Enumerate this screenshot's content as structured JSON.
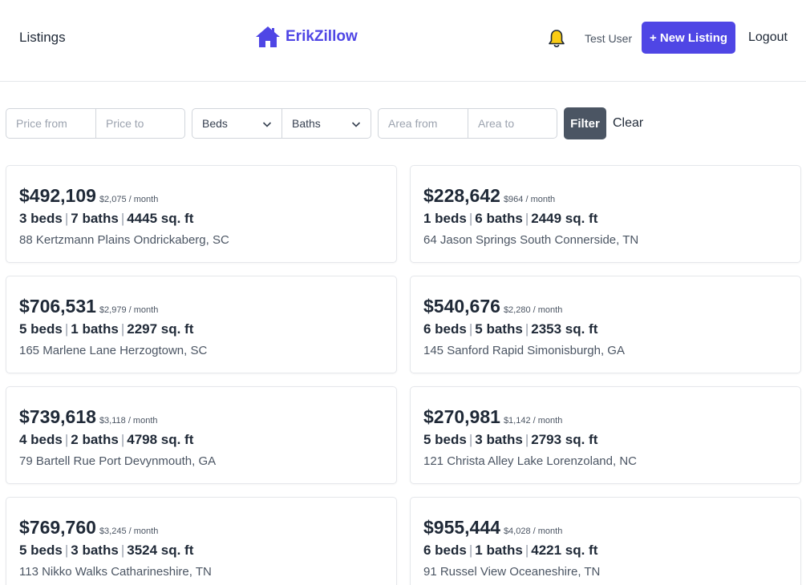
{
  "header": {
    "nav_listings": "Listings",
    "brand_name": "ErikZillow",
    "user_name": "Test User",
    "new_listing_label": "+ New Listing",
    "logout_label": "Logout",
    "brand_color": "#4f46e5",
    "bell_color": "#facc15"
  },
  "filters": {
    "price_from_placeholder": "Price from",
    "price_to_placeholder": "Price to",
    "beds_label": "Beds",
    "baths_label": "Baths",
    "area_from_placeholder": "Area from",
    "area_to_placeholder": "Area to",
    "filter_label": "Filter",
    "clear_label": "Clear"
  },
  "listings": [
    {
      "price": "$492,109",
      "monthly": "$2,075 / month",
      "beds": "3 beds",
      "baths": "7 baths",
      "area": "4445 sq. ft",
      "address": "88 Kertzmann Plains Ondrickaberg, SC"
    },
    {
      "price": "$228,642",
      "monthly": "$964 / month",
      "beds": "1 beds",
      "baths": "6 baths",
      "area": "2449 sq. ft",
      "address": "64 Jason Springs South Connerside, TN"
    },
    {
      "price": "$706,531",
      "monthly": "$2,979 / month",
      "beds": "5 beds",
      "baths": "1 baths",
      "area": "2297 sq. ft",
      "address": "165 Marlene Lane Herzogtown, SC"
    },
    {
      "price": "$540,676",
      "monthly": "$2,280 / month",
      "beds": "6 beds",
      "baths": "5 baths",
      "area": "2353 sq. ft",
      "address": "145 Sanford Rapid Simonisburgh, GA"
    },
    {
      "price": "$739,618",
      "monthly": "$3,118 / month",
      "beds": "4 beds",
      "baths": "2 baths",
      "area": "4798 sq. ft",
      "address": "79 Bartell Rue Port Devynmouth, GA"
    },
    {
      "price": "$270,981",
      "monthly": "$1,142 / month",
      "beds": "5 beds",
      "baths": "3 baths",
      "area": "2793 sq. ft",
      "address": "121 Christa Alley Lake Lorenzoland, NC"
    },
    {
      "price": "$769,760",
      "monthly": "$3,245 / month",
      "beds": "5 beds",
      "baths": "3 baths",
      "area": "3524 sq. ft",
      "address": "113 Nikko Walks Catharineshire, TN"
    },
    {
      "price": "$955,444",
      "monthly": "$4,028 / month",
      "beds": "6 beds",
      "baths": "1 baths",
      "area": "4221 sq. ft",
      "address": "91 Russel View Oceaneshire, TN"
    }
  ]
}
